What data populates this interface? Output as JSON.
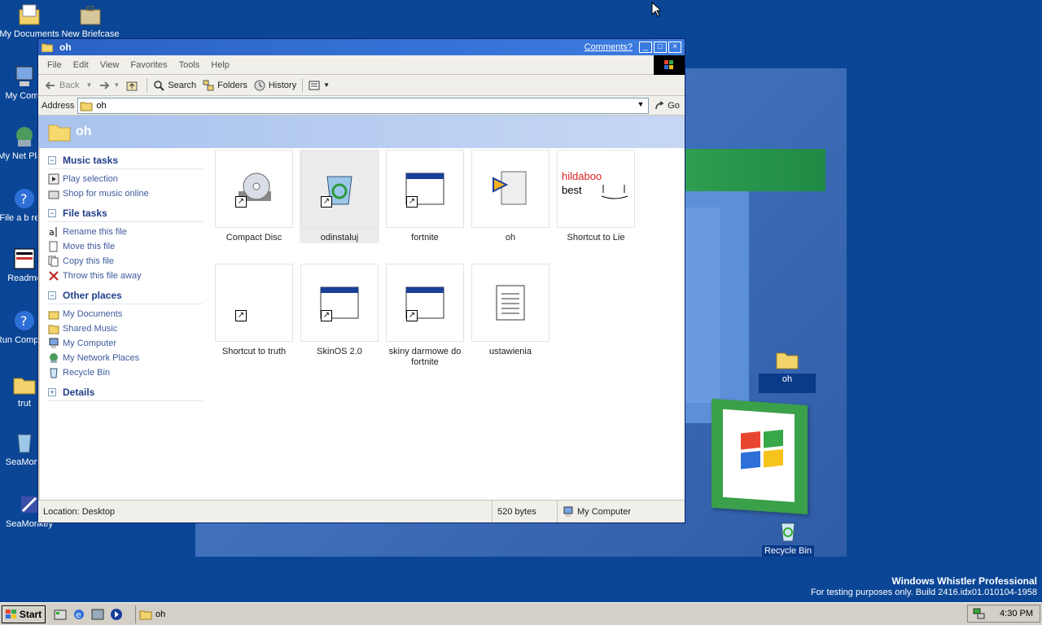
{
  "desktop": {
    "icons": [
      {
        "label": "My Documents",
        "icon": "my-documents-icon"
      },
      {
        "label": "New Briefcase",
        "icon": "briefcase-icon"
      },
      {
        "label": "My Comp",
        "icon": "my-computer-icon"
      },
      {
        "label": "My Net Place",
        "icon": "network-icon"
      },
      {
        "label": "File a b repo",
        "icon": "help-icon"
      },
      {
        "label": "Readme",
        "icon": "readme-icon"
      },
      {
        "label": "Run Compatib",
        "icon": "help-icon"
      },
      {
        "label": "trut",
        "icon": "folder-icon"
      },
      {
        "label": "SeaMonk",
        "icon": "recycle-full-icon"
      },
      {
        "label": "SeaMonkey",
        "icon": "seamonkey-icon"
      },
      {
        "label": "oh",
        "icon": "folder-icon"
      },
      {
        "label": "Recycle Bin",
        "icon": "recycle-bin-icon"
      }
    ],
    "build_line1": "Windows Whistler Professional",
    "build_line2": "For testing purposes only. Build 2416.idx01.010104-1958"
  },
  "window": {
    "title": "oh",
    "comments_link": "Comments?",
    "menu": [
      "File",
      "Edit",
      "View",
      "Favorites",
      "Tools",
      "Help"
    ],
    "toolbar": {
      "back": "Back",
      "search": "Search",
      "folders": "Folders",
      "history": "History"
    },
    "address": {
      "label": "Address",
      "value": "oh",
      "go": "Go"
    },
    "header_title": "oh",
    "taskpane": {
      "music": {
        "title": "Music tasks",
        "items": [
          "Play selection",
          "Shop for music online"
        ]
      },
      "file": {
        "title": "File tasks",
        "items": [
          "Rename this file",
          "Move this file",
          "Copy this file",
          "Throw this file away"
        ]
      },
      "other": {
        "title": "Other places",
        "items": [
          "My Documents",
          "Shared Music",
          "My Computer",
          "My Network Places",
          "Recycle Bin"
        ]
      },
      "details": {
        "title": "Details"
      }
    },
    "files": [
      {
        "name": "Compact Disc",
        "icon": "cd-icon"
      },
      {
        "name": "odinstaluj",
        "icon": "recycle-icon"
      },
      {
        "name": "fortnite",
        "icon": "window-icon"
      },
      {
        "name": "oh",
        "icon": "media-icon"
      },
      {
        "name": "Shortcut to Lie",
        "icon": "image-thumb",
        "thumb_line1": "hildaboo",
        "thumb_line2": "best"
      },
      {
        "name": "Shortcut to truth",
        "icon": "shortcut-icon"
      },
      {
        "name": "SkinOS 2.0",
        "icon": "window-icon"
      },
      {
        "name": "skiny darmowe do fortnite",
        "icon": "window-icon"
      },
      {
        "name": "ustawienia",
        "icon": "notepad-icon"
      }
    ],
    "status": {
      "location": "Location: Desktop",
      "size": "520 bytes",
      "zone": "My Computer"
    }
  },
  "taskbar": {
    "start": "Start",
    "task": "oh",
    "clock": "4:30 PM"
  },
  "colors": {
    "desktop": "#0b4696",
    "titlebar": "#2a62c4",
    "header": "#a9c3ee",
    "link": "#3d5a9c"
  }
}
